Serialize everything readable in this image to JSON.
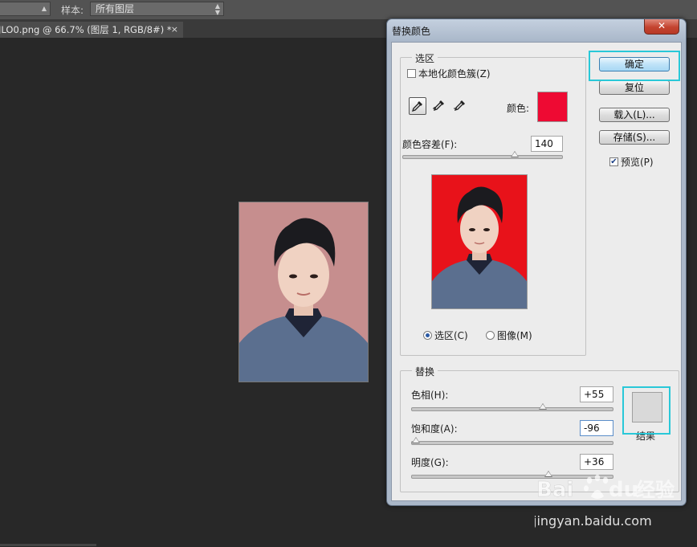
{
  "optbar": {
    "select1": "",
    "sample_label": "样本:",
    "sample_select": "所有图层"
  },
  "tab": {
    "title": "JLO0.png @ 66.7% (图层 1, RGB/8#) *",
    "close": "×"
  },
  "dialog": {
    "title": "替换颜色",
    "close": "✕",
    "selection": {
      "legend": "选区",
      "localized_label": "本地化颜色簇(Z)",
      "localized_checked": false,
      "color_label": "颜色:",
      "color_swatch": "#ee0a33",
      "fuzziness_label": "颜色容差(F):",
      "fuzziness_value": "140",
      "fuzziness_level": 140,
      "fuzziness_max": 200,
      "radio_selection": "选区(C)",
      "radio_image": "图像(M)",
      "preview_bg": "#e8121a"
    },
    "replace": {
      "legend": "替换",
      "hue_label": "色相(H):",
      "hue_value": "+55",
      "hue_level": 55,
      "saturation_label": "饱和度(A):",
      "saturation_value": "-96",
      "saturation_level": -96,
      "lightness_label": "明度(G):",
      "lightness_value": "+36",
      "lightness_level": 36,
      "result_label": "结果",
      "result_color": "#d9d9d9"
    },
    "buttons": {
      "ok": "确定",
      "reset": "复位",
      "load": "载入(L)...",
      "save": "存储(S)..."
    },
    "preview_label": "预览(P)",
    "preview_checked": true
  },
  "canvas": {
    "photo_bg": "#c68e8e"
  },
  "watermark": {
    "brand": "Bai",
    "brand_tail": "du",
    "cn": "经验",
    "url": "jingyan.baidu.com"
  }
}
